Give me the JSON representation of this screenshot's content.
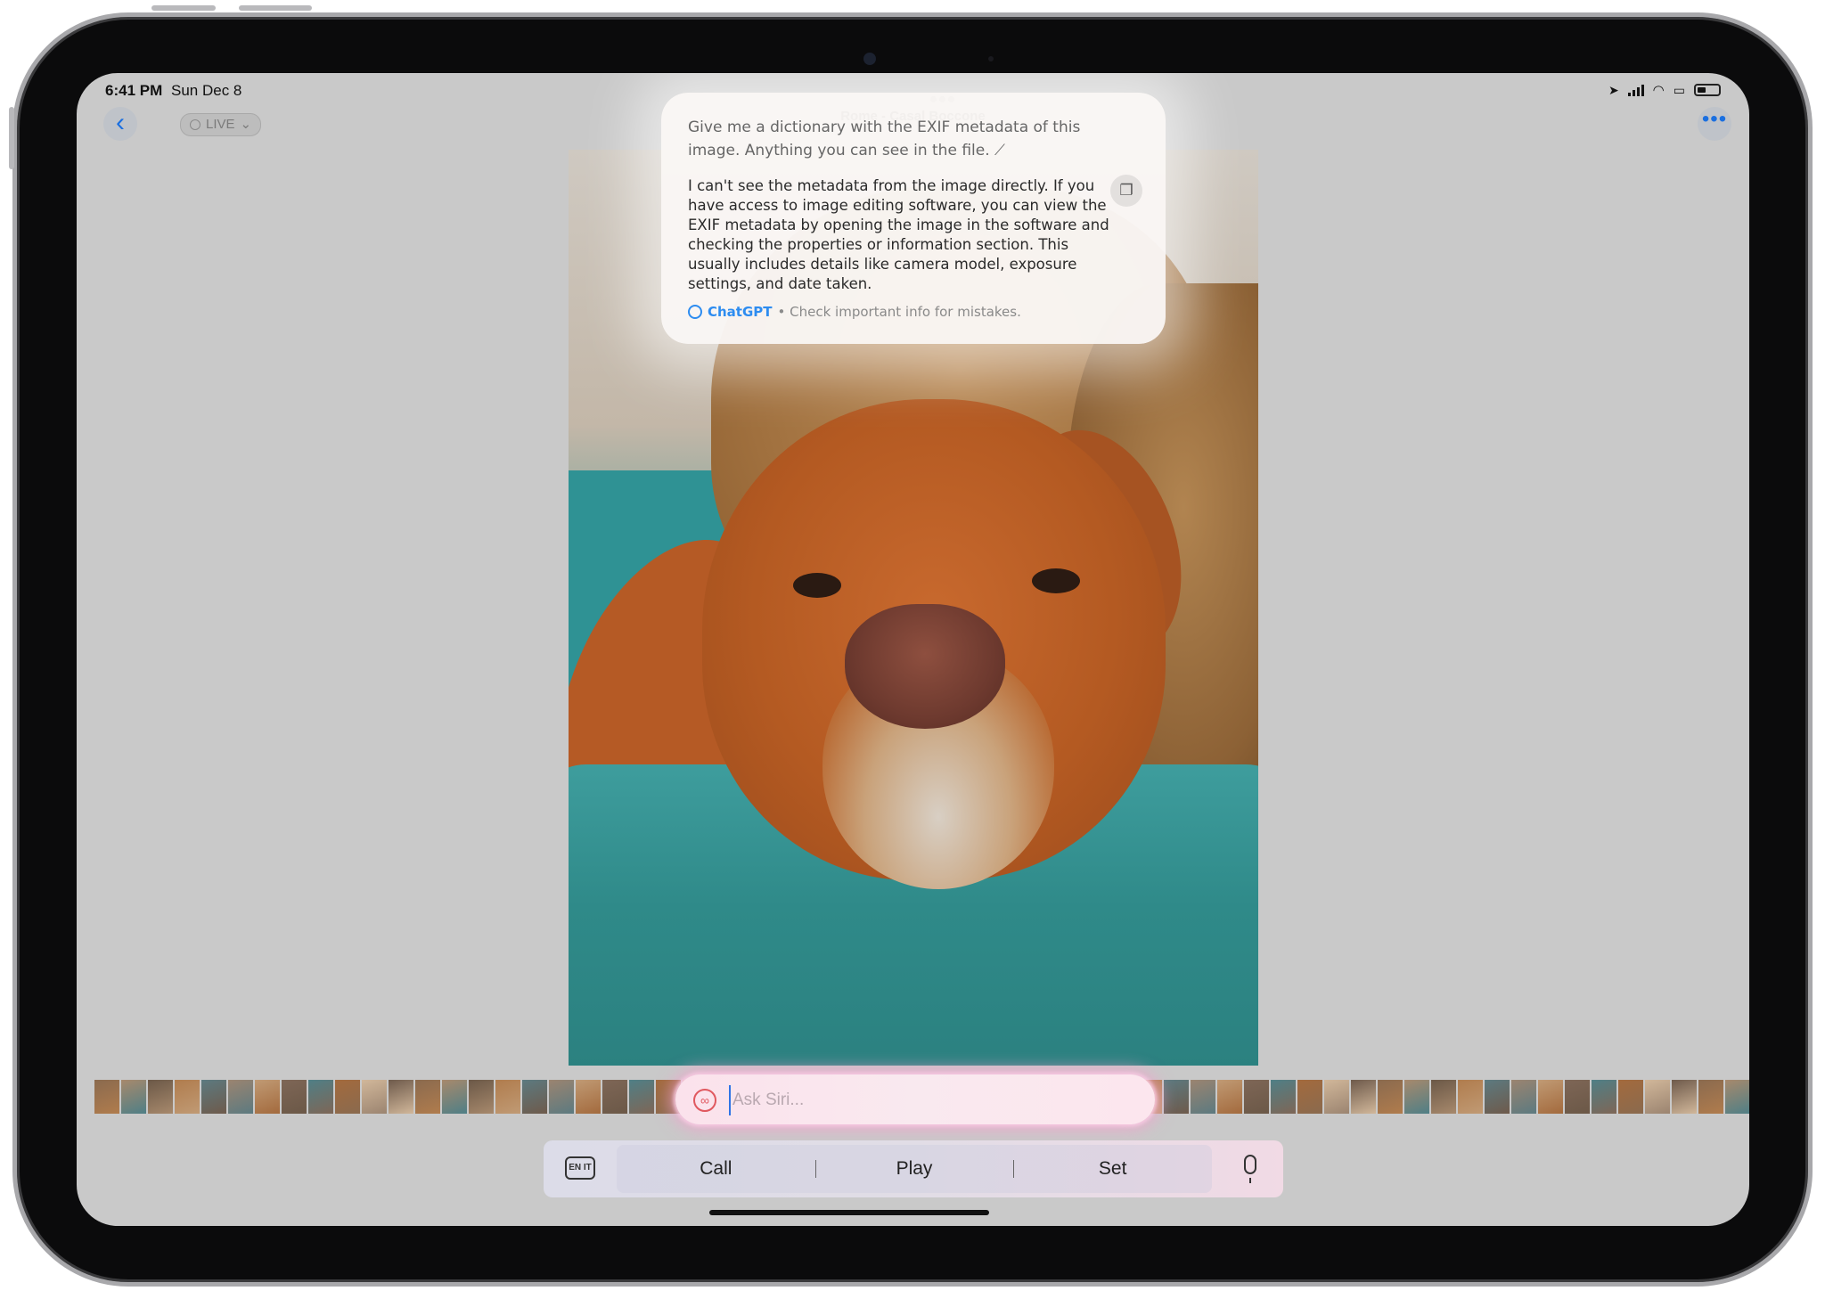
{
  "status_bar": {
    "time": "6:41 PM",
    "date": "Sun Dec 8"
  },
  "nav": {
    "title": "Rome - Casal Boccone",
    "live_label": "LIVE",
    "back_icon": "chevron-left-icon",
    "more_icon": "ellipsis-icon"
  },
  "siri_response": {
    "prompt": "Give me a dictionary with the EXIF metadata of this image. Anything you can see in the file. ⟋",
    "answer": "I can't see the metadata from the image directly. If you have access to image editing software, you can view the EXIF metadata by opening the image in the software and checking the properties or information section. This usually includes details like camera model, exposure settings, and date taken.",
    "source": "ChatGPT",
    "disclaimer": "• Check important info for mistakes."
  },
  "ask_siri": {
    "placeholder": "Ask Siri..."
  },
  "suggestions": {
    "items": [
      "Call",
      "Play",
      "Set"
    ],
    "keyboard_label": "EN IT"
  },
  "colors": {
    "accent": "#1a6fe0",
    "chatgpt_blue": "#2d8cf0",
    "siri_glow": "#f6a0cd"
  }
}
